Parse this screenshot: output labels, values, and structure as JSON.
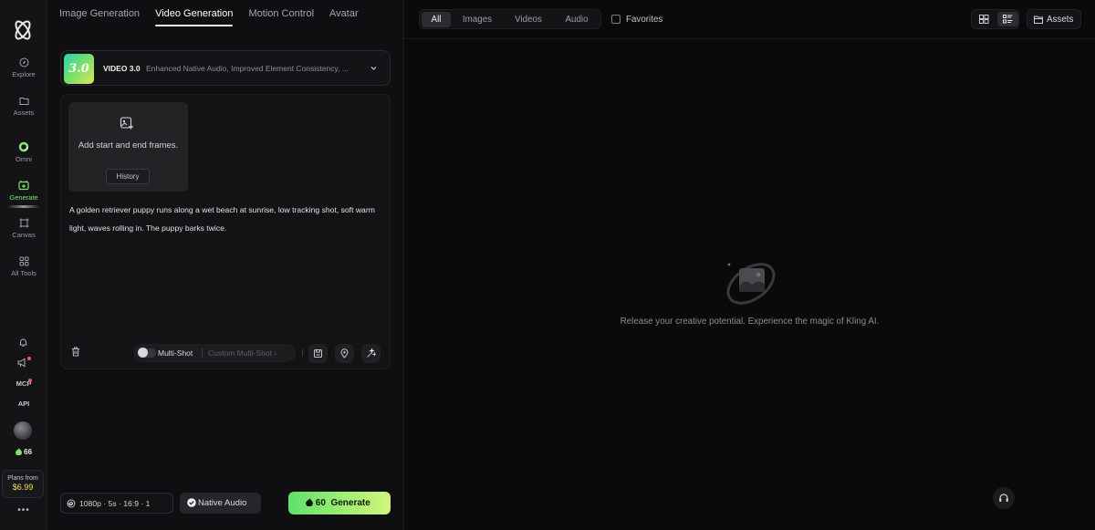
{
  "sidebar": {
    "logo_icon": "kling-logo-icon",
    "items": [
      {
        "label": "Explore",
        "icon": "compass-icon"
      },
      {
        "label": "Assets",
        "icon": "folder-icon"
      },
      {
        "label": "Omni",
        "icon": "omni-ring-icon"
      },
      {
        "label": "Generate",
        "icon": "generate-icon",
        "active": true
      },
      {
        "label": "Canvas",
        "icon": "canvas-icon"
      },
      {
        "label": "All Tools",
        "icon": "grid-icon"
      }
    ],
    "mcp_label": "MCP",
    "api_label": "API",
    "credits": "66",
    "plans_label": "Plans from",
    "plans_price": "$6.99",
    "more": "•••"
  },
  "tabs": [
    {
      "label": "Image Generation",
      "active": false
    },
    {
      "label": "Video Generation",
      "active": true
    },
    {
      "label": "Motion Control",
      "active": false
    },
    {
      "label": "Avatar",
      "active": false
    }
  ],
  "model": {
    "badge": "3.0",
    "name": "VIDEO 3.0",
    "description": "Enhanced Native Audio, Improved Element Consistency, ..."
  },
  "frames": {
    "label": "Add start and end frames.",
    "history_label": "History"
  },
  "prompt": "A golden retriever puppy runs along a wet beach at sunrise, low tracking shot, soft warm light, waves rolling in. The puppy barks twice.",
  "multishot": {
    "label": "Multi-Shot",
    "custom_label": "Custom Multi-Shot",
    "enabled": false
  },
  "settings": {
    "summary": "1080p · 5s · 16:9 · 1",
    "native_audio_label": "Native Audio",
    "native_audio_enabled": true
  },
  "generate": {
    "cost": "60",
    "label": "Generate"
  },
  "filters": [
    {
      "label": "All",
      "active": true
    },
    {
      "label": "Images",
      "active": false
    },
    {
      "label": "Videos",
      "active": false
    },
    {
      "label": "Audio",
      "active": false
    }
  ],
  "favorites_label": "Favorites",
  "assets_label": "Assets",
  "empty_message": "Release your creative potential. Experience the magic of Kling AI.",
  "colors": {
    "accent": "#7ee26a",
    "generate_gradient_start": "#5fe06c",
    "generate_gradient_end": "#d0f57e",
    "price": "#f2e05a"
  }
}
